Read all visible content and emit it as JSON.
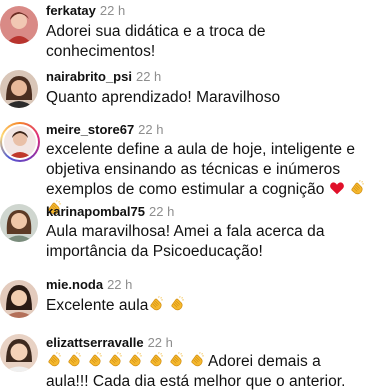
{
  "comments": [
    {
      "username": "ferkatay",
      "time": "22 h",
      "text": "Adorei sua didática e a troca de conhecimentos!",
      "emojis": []
    },
    {
      "username": "nairabrito_psi",
      "time": "22 h",
      "text": "Quanto aprendizado! Maravilhoso",
      "emojis": []
    },
    {
      "username": "meire_store67",
      "time": "22 h",
      "text_lines": [
        "excelente define a aula de hoje, inteligente e",
        "objetiva ensinando as técnicas e inúmeros",
        "exemplos de como estimular a cognição"
      ],
      "emojis": [
        "red-heart",
        "clapping-hands",
        "clapping-hands"
      ]
    },
    {
      "username": "karinapombal75",
      "time": "22 h",
      "text_lines": [
        "Aula maravilhosa! Amei a fala acerca da",
        "importância da Psicoeducação!"
      ],
      "emojis": []
    },
    {
      "username": "mie.noda",
      "time": "22 h",
      "text": "Excelente aula",
      "emojis": [
        "clapping-hands",
        "clapping-hands"
      ]
    },
    {
      "username": "elizattserravalle",
      "time": "22 h",
      "emojis_leading": [
        "clapping-hands",
        "clapping-hands",
        "clapping-hands",
        "clapping-hands",
        "clapping-hands",
        "clapping-hands",
        "clapping-hands",
        "clapping-hands"
      ],
      "text_line1": "Adorei demais a",
      "text_line2": "aula!!! Cada dia está melhor que o anterior."
    }
  ],
  "colors": {
    "username": "#111111",
    "timestamp": "#8e8e8e",
    "text": "#111111",
    "story_ring": "#dd2a7b",
    "heart": "#e0102a",
    "clap": "#f5b82e"
  }
}
